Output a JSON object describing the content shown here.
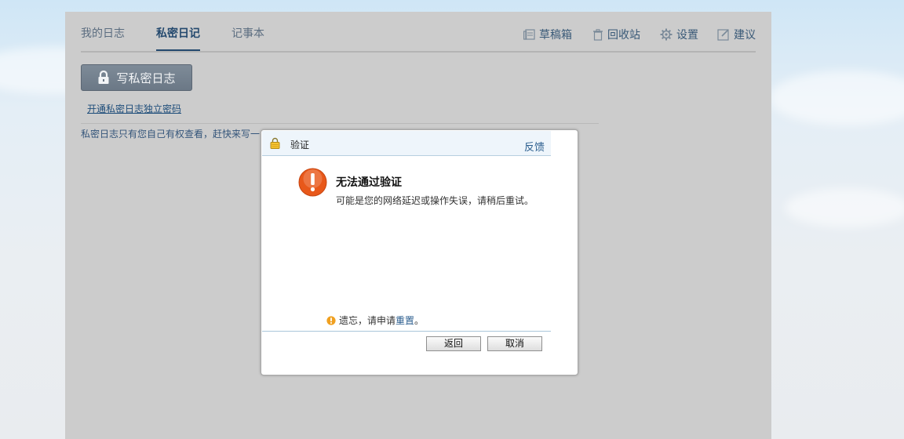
{
  "tabs": [
    {
      "label": "我的日志"
    },
    {
      "label": "私密日记"
    },
    {
      "label": "记事本"
    }
  ],
  "tools": [
    {
      "label": "草稿箱",
      "icon": "draft-icon"
    },
    {
      "label": "回收站",
      "icon": "trash-icon"
    },
    {
      "label": "设置",
      "icon": "gear-icon"
    },
    {
      "label": "建议",
      "icon": "edit-icon"
    }
  ],
  "write_button": {
    "label": "写私密日志",
    "icon": "lock-icon"
  },
  "password_link": "开通私密日志独立密码",
  "hint_text": "私密日志只有您自己有权查看，赶快来写一",
  "dialog": {
    "title": "验证",
    "feedback": "反馈",
    "error_title": "无法通过验证",
    "error_desc": "可能是您的网络延迟或操作失误，请稍后重试。",
    "forgot_prefix": "遗忘，请申请",
    "forgot_link": "重置",
    "forgot_suffix": "。",
    "back_button": "返回",
    "cancel_button": "取消"
  },
  "colors": {
    "accent": "#24496e",
    "warning": "#e8581a",
    "info": "#f0a020"
  }
}
